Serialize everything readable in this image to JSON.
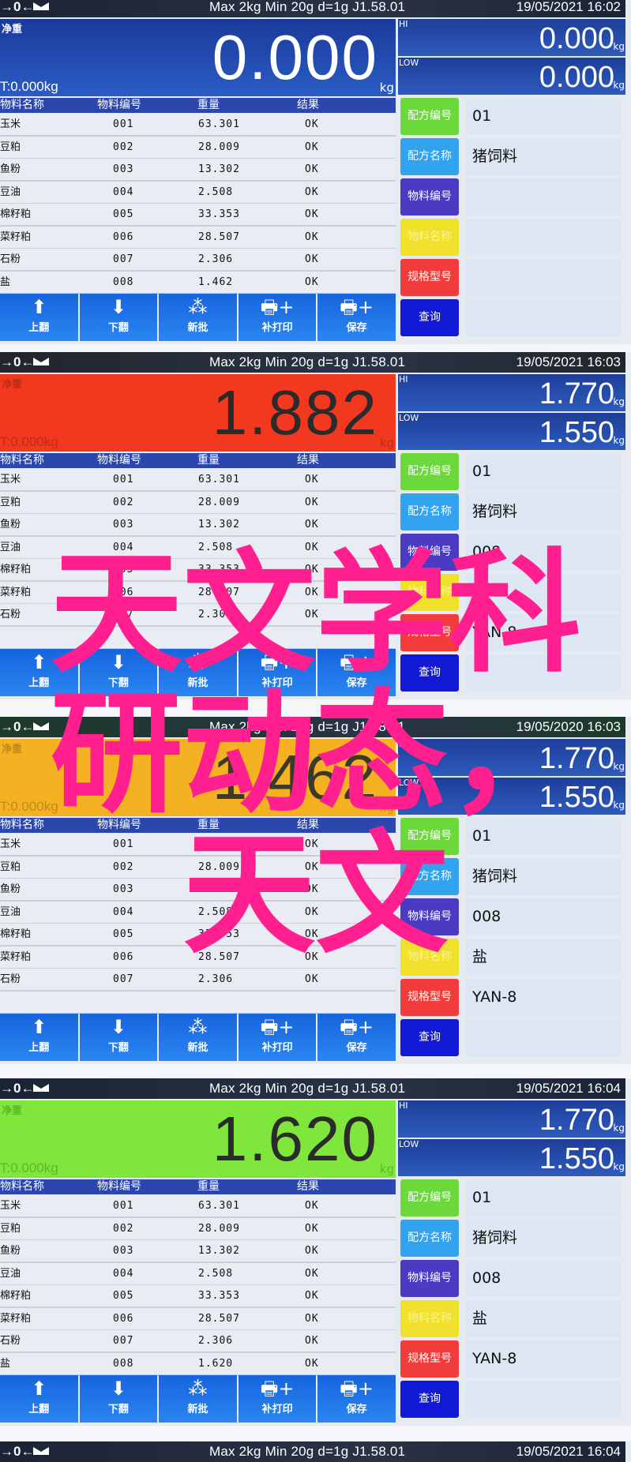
{
  "common": {
    "status_icons": "→0←",
    "specs": "Max 2kg  Min 20g  d=1g    J1.58.01",
    "display_label": "净重",
    "tare": "T:0.000kg",
    "unit": "kg",
    "hi_label": "HI",
    "low_label": "LOW",
    "table_headers": [
      "物料名称",
      "物料编号",
      "重量",
      "结果"
    ],
    "buttons": [
      {
        "label": "上翻",
        "icon": "arrow-up-icon"
      },
      {
        "label": "下翻",
        "icon": "arrow-down-icon"
      },
      {
        "label": "新批",
        "icon": "batch-stack-icon"
      },
      {
        "label": "补打印",
        "icon": "printer-plus-icon"
      },
      {
        "label": "保存",
        "icon": "printer-plus-icon"
      }
    ],
    "side_buttons": [
      {
        "label": "配方编号",
        "color": "#6cd83c"
      },
      {
        "label": "配方名称",
        "color": "#31a3ef"
      },
      {
        "label": "物料编号",
        "color": "#4a3bc2"
      },
      {
        "label": "物料名称",
        "color": "#f0e22c"
      },
      {
        "label": "规格型号",
        "color": "#f23b3b"
      },
      {
        "label": "查询",
        "color": "#1119d6"
      }
    ]
  },
  "panels": [
    {
      "datetime": "19/05/2021  16:02",
      "status_bg": "#1b2436",
      "weight": "0.000",
      "display_bg": "#2049ae",
      "digit_color": "#ffffff",
      "hi_value": "0.000",
      "low_value": "0.000",
      "rows": [
        [
          "玉米",
          "001",
          "63.301",
          "OK"
        ],
        [
          "豆粕",
          "002",
          "28.009",
          "OK"
        ],
        [
          "鱼粉",
          "003",
          "13.302",
          "OK"
        ],
        [
          "豆油",
          "004",
          "2.508",
          "OK"
        ],
        [
          "棉籽粕",
          "005",
          "33.353",
          "OK"
        ],
        [
          "菜籽粕",
          "006",
          "28.507",
          "OK"
        ],
        [
          "石粉",
          "007",
          "2.306",
          "OK"
        ],
        [
          "盐",
          "008",
          "1.462",
          "OK"
        ]
      ],
      "side_values": [
        "01",
        "猪饲料",
        "",
        "",
        "",
        ""
      ]
    },
    {
      "datetime": "19/05/2021  16:03",
      "status_bg": "#23252c",
      "weight": "1.882",
      "display_bg": "#f2391f",
      "digit_color": "#2b2b2b",
      "hi_value": "1.770",
      "low_value": "1.550",
      "rows": [
        [
          "玉米",
          "001",
          "63.301",
          "OK"
        ],
        [
          "豆粕",
          "002",
          "28.009",
          "OK"
        ],
        [
          "鱼粉",
          "003",
          "13.302",
          "OK"
        ],
        [
          "豆油",
          "004",
          "2.508",
          "OK"
        ],
        [
          "棉籽粕",
          "005",
          "33.353",
          "OK"
        ],
        [
          "菜籽粕",
          "006",
          "28.507",
          "OK"
        ],
        [
          "石粉",
          "007",
          "2.306",
          "OK"
        ],
        [
          "",
          "",
          "",
          ""
        ]
      ],
      "side_values": [
        "01",
        "猪饲料",
        "008",
        "盐",
        "YAN-8",
        ""
      ]
    },
    {
      "datetime": "19/05/2020  16:03",
      "status_bg": "#1c3a2a",
      "weight": "1.462",
      "display_bg": "#f4b122",
      "digit_color": "#3a3a2a",
      "hi_value": "1.770",
      "low_value": "1.550",
      "rows": [
        [
          "玉米",
          "001",
          "63.301",
          "OK"
        ],
        [
          "豆粕",
          "002",
          "28.009",
          "OK"
        ],
        [
          "鱼粉",
          "003",
          "13.302",
          "OK"
        ],
        [
          "豆油",
          "004",
          "2.508",
          "OK"
        ],
        [
          "棉籽粕",
          "005",
          "33.353",
          "OK"
        ],
        [
          "菜籽粕",
          "006",
          "28.507",
          "OK"
        ],
        [
          "石粉",
          "007",
          "2.306",
          "OK"
        ],
        [
          "",
          "",
          "",
          ""
        ]
      ],
      "side_values": [
        "01",
        "猪饲料",
        "008",
        "盐",
        "YAN-8",
        ""
      ]
    },
    {
      "datetime": "19/05/2021  16:04",
      "status_bg": "#1b2436",
      "weight": "1.620",
      "display_bg": "#7fe63b",
      "digit_color": "#2b2b2b",
      "hi_value": "1.770",
      "low_value": "1.550",
      "rows": [
        [
          "玉米",
          "001",
          "63.301",
          "OK"
        ],
        [
          "豆粕",
          "002",
          "28.009",
          "OK"
        ],
        [
          "鱼粉",
          "003",
          "13.302",
          "OK"
        ],
        [
          "豆油",
          "004",
          "2.508",
          "OK"
        ],
        [
          "棉籽粕",
          "005",
          "33.353",
          "OK"
        ],
        [
          "菜籽粕",
          "006",
          "28.507",
          "OK"
        ],
        [
          "石粉",
          "007",
          "2.306",
          "OK"
        ],
        [
          "盐",
          "008",
          "1.620",
          "OK"
        ]
      ],
      "side_values": [
        "01",
        "猪饲料",
        "008",
        "盐",
        "YAN-8",
        ""
      ]
    }
  ],
  "bottom_status": {
    "datetime": "19/05/2021  16:04",
    "status_bg": "#1b2436"
  },
  "overlay": {
    "lines": [
      "天文学科",
      "研动态，",
      "天文"
    ],
    "color": "#ff1f8e"
  }
}
